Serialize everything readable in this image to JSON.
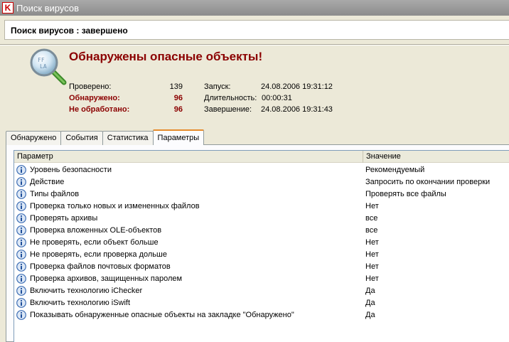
{
  "window": {
    "title": "Поиск вирусов",
    "app_icon_letter": "K",
    "brand_color": "#cc0000"
  },
  "status": {
    "text": "Поиск вирусов : завершено"
  },
  "result": {
    "headline": "Обнаружены опасные объекты!",
    "headline_color": "#8b0000",
    "icon": "magnifier-scan-icon"
  },
  "stats": {
    "checked_label": "Проверено:",
    "checked_value": "139",
    "detected_label": "Обнаружено:",
    "detected_value": "96",
    "unprocessed_label": "Не обработано:",
    "unprocessed_value": "96",
    "start_label": "Запуск:",
    "start_value": "24.08.2006 19:31:12",
    "duration_label": "Длительность:",
    "duration_value": "00:00:31",
    "end_label": "Завершение:",
    "end_value": "24.08.2006 19:31:43"
  },
  "tabs": [
    {
      "label": "Обнаружено",
      "active": false
    },
    {
      "label": "События",
      "active": false
    },
    {
      "label": "Статистика",
      "active": false
    },
    {
      "label": "Параметры",
      "active": true
    }
  ],
  "table": {
    "columns": [
      "Параметр",
      "Значение"
    ],
    "row_icon": "info-icon",
    "rows": [
      {
        "param": "Уровень безопасности",
        "value": "Рекомендуемый"
      },
      {
        "param": "Действие",
        "value": "Запросить по окончании проверки"
      },
      {
        "param": "Типы файлов",
        "value": "Проверять все файлы"
      },
      {
        "param": "Проверка только новых и измененных файлов",
        "value": "Нет"
      },
      {
        "param": "Проверять архивы",
        "value": "все"
      },
      {
        "param": "Проверка вложенных OLE-объектов",
        "value": "все"
      },
      {
        "param": "Не проверять, если объект больше",
        "value": "Нет"
      },
      {
        "param": "Не проверять, если проверка дольше",
        "value": "Нет"
      },
      {
        "param": "Проверка файлов почтовых форматов",
        "value": "Нет"
      },
      {
        "param": "Проверка архивов, защищенных паролем",
        "value": "Нет"
      },
      {
        "param": "Включить технологию iChecker",
        "value": "Да"
      },
      {
        "param": "Включить технологию iSwift",
        "value": "Да"
      },
      {
        "param": "Показывать обнаруженные опасные объекты на закладке \"Обнаружено\"",
        "value": "Да"
      }
    ]
  }
}
